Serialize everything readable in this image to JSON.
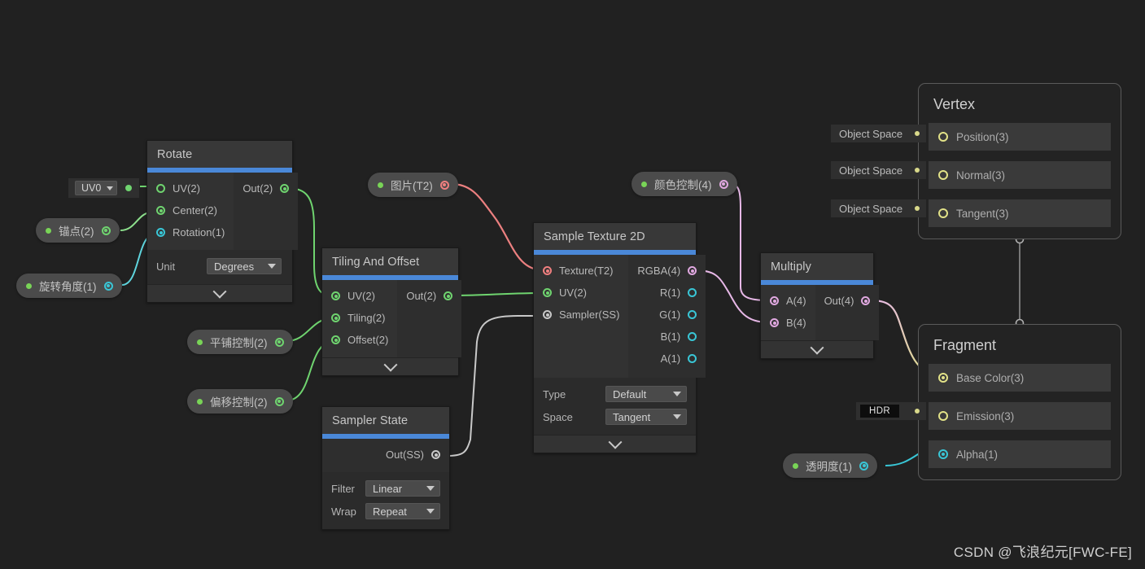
{
  "app": {
    "name": "Unity Shader Graph",
    "background_color": "#212121",
    "accent_color": "#4a88d8"
  },
  "watermark": "CSDN @飞浪纪元[FWC-FE]",
  "uv0_node": {
    "value": "UV0",
    "out_label": ""
  },
  "properties": [
    {
      "id": "anchor",
      "label": "锚点(2)",
      "slot_color": "#6fd46f"
    },
    {
      "id": "rotation",
      "label": "旋转角度(1)",
      "slot_color": "#39c6d6"
    },
    {
      "id": "tiling",
      "label": "平铺控制(2)",
      "slot_color": "#6fd46f"
    },
    {
      "id": "offset",
      "label": "偏移控制(2)",
      "slot_color": "#6fd46f"
    },
    {
      "id": "texture",
      "label": "图片(T2)",
      "slot_color": "#f07f7f"
    },
    {
      "id": "color",
      "label": "颜色控制(4)",
      "slot_color": "#e0a8e0"
    },
    {
      "id": "alpha",
      "label": "透明度(1)",
      "slot_color": "#39c6d6"
    }
  ],
  "nodes": {
    "rotate": {
      "title": "Rotate",
      "inputs": [
        "UV(2)",
        "Center(2)",
        "Rotation(1)"
      ],
      "outputs": [
        "Out(2)"
      ],
      "fields": [
        {
          "label": "Unit",
          "value": "Degrees"
        }
      ]
    },
    "tiling_and_offset": {
      "title": "Tiling And Offset",
      "inputs": [
        "UV(2)",
        "Tiling(2)",
        "Offset(2)"
      ],
      "outputs": [
        "Out(2)"
      ],
      "fields": []
    },
    "sampler_state": {
      "title": "Sampler State",
      "inputs": [],
      "outputs": [
        "Out(SS)"
      ],
      "fields": [
        {
          "label": "Filter",
          "value": "Linear"
        },
        {
          "label": "Wrap",
          "value": "Repeat"
        }
      ]
    },
    "sample_texture_2d": {
      "title": "Sample Texture 2D",
      "inputs": [
        "Texture(T2)",
        "UV(2)",
        "Sampler(SS)"
      ],
      "outputs": [
        "RGBA(4)",
        "R(1)",
        "G(1)",
        "B(1)",
        "A(1)"
      ],
      "fields": [
        {
          "label": "Type",
          "value": "Default"
        },
        {
          "label": "Space",
          "value": "Tangent"
        }
      ]
    },
    "multiply": {
      "title": "Multiply",
      "inputs": [
        "A(4)",
        "B(4)"
      ],
      "outputs": [
        "Out(4)"
      ],
      "fields": []
    }
  },
  "masters": {
    "vertex": {
      "title": "Vertex",
      "rows": [
        {
          "label": "Position(3)",
          "space": "Object Space"
        },
        {
          "label": "Normal(3)",
          "space": "Object Space"
        },
        {
          "label": "Tangent(3)",
          "space": "Object Space"
        }
      ]
    },
    "fragment": {
      "title": "Fragment",
      "rows": [
        {
          "label": "Base Color(3)",
          "tag": ""
        },
        {
          "label": "Emission(3)",
          "tag": "HDR"
        },
        {
          "label": "Alpha(1)",
          "tag": ""
        }
      ]
    }
  }
}
